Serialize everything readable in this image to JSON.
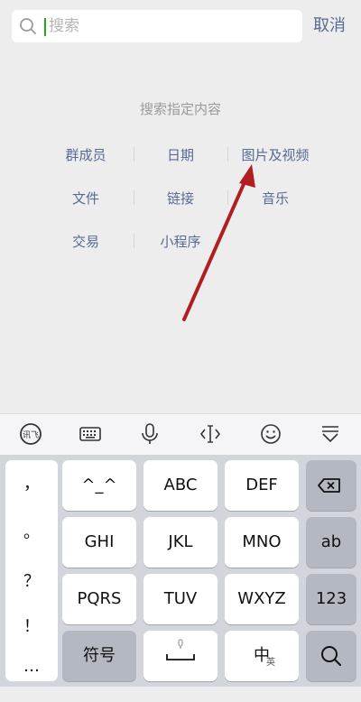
{
  "search": {
    "placeholder": "搜索",
    "cancel_label": "取消"
  },
  "categories": {
    "title": "搜索指定内容",
    "items": [
      "群成员",
      "日期",
      "图片及视频",
      "文件",
      "链接",
      "音乐",
      "交易",
      "小程序"
    ]
  },
  "keyboard": {
    "toolbar_icons": [
      "sogou-logo-icon",
      "keyboard-icon",
      "microphone-icon",
      "cursor-move-icon",
      "emoji-icon",
      "collapse-keyboard-icon"
    ],
    "punctuation": [
      "，",
      "。",
      "？",
      "！",
      "…"
    ],
    "keys": {
      "row1": [
        "^_^",
        "ABC",
        "DEF"
      ],
      "row2": [
        "GHI",
        "JKL",
        "MNO",
        "ab"
      ],
      "row3": [
        "PQRS",
        "TUV",
        "WXYZ",
        "123"
      ],
      "symbols_label": "符号",
      "lang_main": "中",
      "lang_sub": "英"
    }
  }
}
